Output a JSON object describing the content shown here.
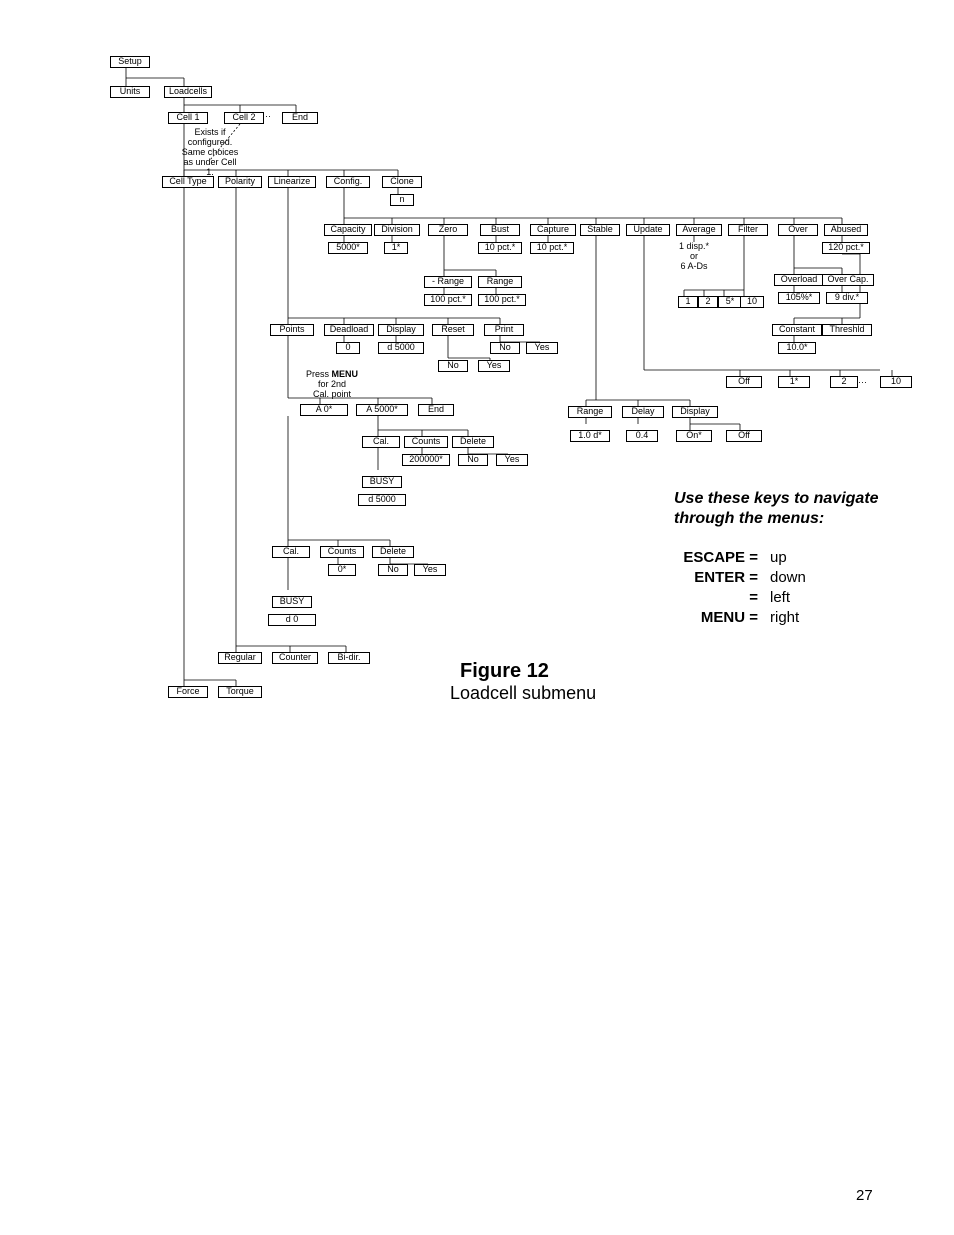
{
  "page_number": "27",
  "figure": {
    "number": "Figure 12",
    "caption": "Loadcell submenu"
  },
  "nav": {
    "heading_line1": "Use these keys to navigate",
    "heading_line2": "through the menus:",
    "rows": [
      {
        "label": "ESCAPE =",
        "val": "up"
      },
      {
        "label": "ENTER =",
        "val": "down"
      },
      {
        "label": "=",
        "val": "left"
      },
      {
        "label": "MENU =",
        "val": "right"
      }
    ]
  },
  "ellipsis": "···",
  "notes": {
    "exists": {
      "l1": "Exists if",
      "l2": "configured.",
      "l3": "Same choices",
      "l4": "as under Cell 1."
    },
    "avg": {
      "l1": "1 disp.*",
      "l2": "or",
      "l3": "6 A-Ds"
    },
    "menu2nd": {
      "l1": "Press MENU",
      "l2": "for 2nd",
      "l3": "Cal. point"
    }
  },
  "boxes": {
    "setup": "Setup",
    "units": "Units",
    "loadcells": "Loadcells",
    "cell1": "Cell 1",
    "cell2": "Cell 2",
    "end1": "End",
    "celltype": "Cell Type",
    "polarity": "Polarity",
    "linearize": "Linearize",
    "config": "Config.",
    "clone": "Clone",
    "n": "n",
    "capacity": "Capacity",
    "division": "Division",
    "zero": "Zero",
    "bust": "Bust",
    "capture": "Capture",
    "stable": "Stable",
    "update": "Update",
    "average": "Average",
    "filter": "Filter",
    "over": "Over",
    "abused": "Abused",
    "cap5000": "5000*",
    "div1": "1*",
    "bust10": "10 pct.*",
    "cap10": "10 pct.*",
    "abused120": "120 pct.*",
    "rangeNeg": "- Range",
    "rangePos": "Range",
    "neg100": "100 pct.*",
    "pos100": "100 pct.*",
    "f1": "1",
    "f2": "2",
    "f5": "5*",
    "f10": "10",
    "overload": "Overload",
    "overcap": "Over Cap.",
    "ovl105": "105%*",
    "ovc9": "9 div.*",
    "points": "Points",
    "deadload": "Deadload",
    "display": "Display",
    "reset": "Reset",
    "print": "Print",
    "pts0": "0",
    "dl5000": "d 5000",
    "prtNo": "No",
    "prtYes": "Yes",
    "rstNo": "No",
    "rstYes": "Yes",
    "constant": "Constant",
    "threshld": "Threshld",
    "thr10": "10.0*",
    "upOff": "Off",
    "up1": "1*",
    "up2": "2",
    "up10": "10",
    "a0": "A   0*",
    "a5000": "A 5000*",
    "end2": "End",
    "cal1": "Cal.",
    "counts1": "Counts",
    "delete1": "Delete",
    "cnt2": "200000*",
    "del1No": "No",
    "del1Yes": "Yes",
    "stRange": "Range",
    "stDelay": "Delay",
    "stDisplay": "Display",
    "stR10": "1.0 d*",
    "stD04": "0.4",
    "stOn": "On*",
    "stOff": "Off",
    "busy1": "BUSY",
    "busy1v": "d 5000",
    "cal2": "Cal.",
    "counts2": "Counts",
    "delete2": "Delete",
    "cnt0": "0*",
    "del2No": "No",
    "del2Yes": "Yes",
    "busy2": "BUSY",
    "busy2v": "d   0",
    "regular": "Regular",
    "counter": "Counter",
    "bidir": "Bi-dir.",
    "force": "Force",
    "torque": "Torque"
  }
}
